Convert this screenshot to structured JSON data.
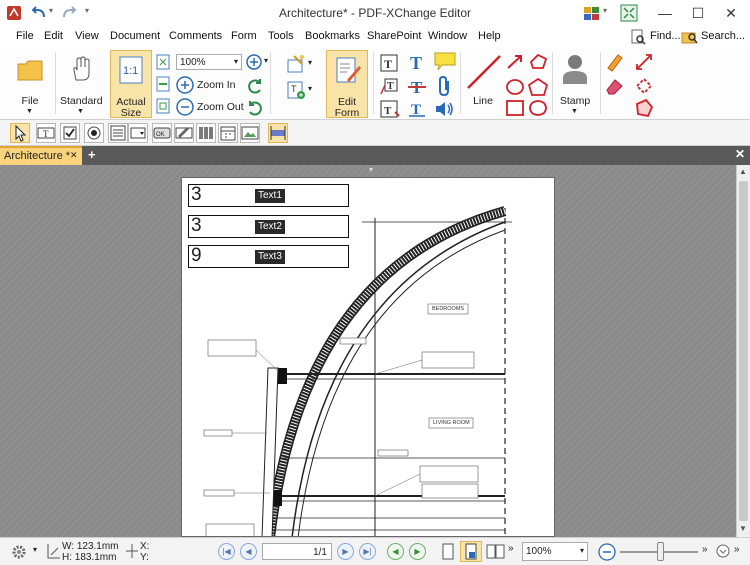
{
  "window": {
    "title": "Architecture* - PDF-XChange Editor"
  },
  "menu": [
    "File",
    "Edit",
    "View",
    "Document",
    "Comments",
    "Form",
    "Tools",
    "Bookmarks",
    "SharePoint",
    "Window",
    "Help"
  ],
  "search": {
    "find_label": "Find...",
    "search_label": "Search..."
  },
  "ribbon": {
    "file_label": "File",
    "standard_label": "Standard",
    "actual_size_label": "Actual Size",
    "zoom_value": "100%",
    "zoom_in_label": "Zoom In",
    "zoom_out_label": "Zoom Out",
    "edit_form_label": "Edit Form",
    "line_label": "Line",
    "stamp_label": "Stamp"
  },
  "tab": {
    "label": "Architecture *"
  },
  "fields": [
    {
      "value": "3",
      "name": "Text1"
    },
    {
      "value": "3",
      "name": "Text2"
    },
    {
      "value": "9",
      "name": "Text3"
    }
  ],
  "drawing": {
    "room1": "BEDROOMS",
    "room2": "LIVING ROOM"
  },
  "status": {
    "width": "W: 123.1mm",
    "height": "H: 183.1mm",
    "x_label": "X:",
    "y_label": "Y:",
    "page": "1/1",
    "zoom": "100%"
  },
  "colors": {
    "accent": "#f8e3a8",
    "tab_active": "#f9d47d",
    "workspace": "#8a8a8a"
  }
}
